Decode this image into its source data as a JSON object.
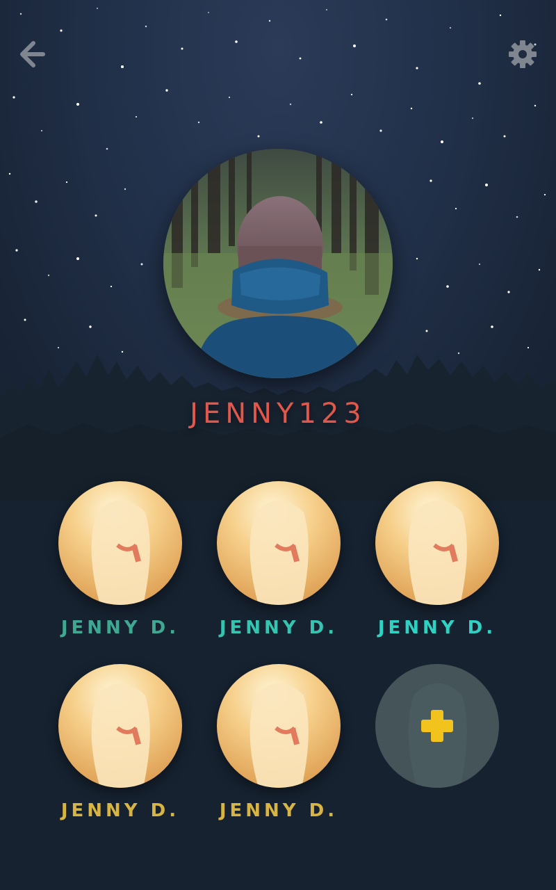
{
  "app": {
    "username": "JENNY123"
  },
  "icons": {
    "back": "arrow-left-icon",
    "settings": "gear-icon",
    "add": "plus-icon"
  },
  "colors": {
    "username": "#e2574a",
    "name_teal_1": "#3ea892",
    "name_teal_2": "#34c4b0",
    "name_teal_3": "#2ed1c2",
    "name_gold": "#d8b443",
    "add_plus": "#f2c21d"
  },
  "friends": [
    {
      "name": "JENNY D.",
      "color": "#3ea892"
    },
    {
      "name": "JENNY D.",
      "color": "#34c4b0"
    },
    {
      "name": "JENNY D.",
      "color": "#2ed1c2"
    },
    {
      "name": "JENNY D.",
      "color": "#d8b443"
    },
    {
      "name": "JENNY D.",
      "color": "#d8b443"
    }
  ]
}
